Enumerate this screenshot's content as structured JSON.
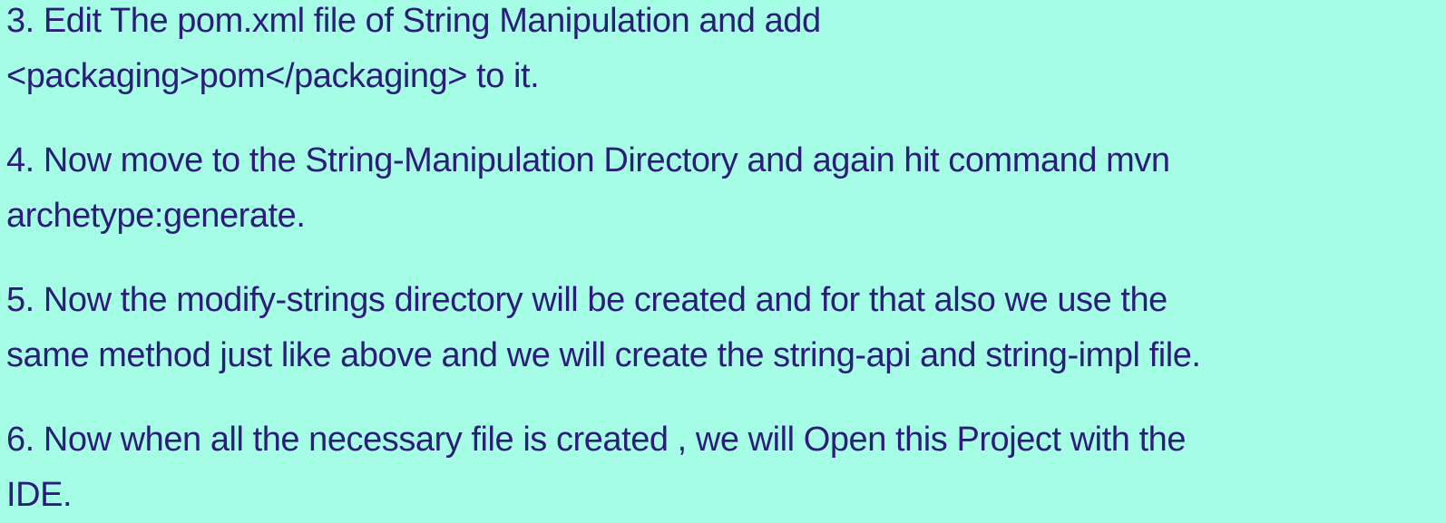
{
  "steps": [
    {
      "lines": [
        "3. Edit The pom.xml file of String Manipulation and add",
        "<packaging>pom</packaging> to it."
      ]
    },
    {
      "lines": [
        "4. Now move to the String-Manipulation Directory and again hit command mvn",
        "archetype:generate."
      ]
    },
    {
      "lines": [
        "5. Now the modify-strings directory will be created and for that also we use the",
        "same method just like above and we will create the string-api and string-impl file."
      ]
    },
    {
      "lines": [
        "6. Now when all the necessary file is created , we will Open this Project with the",
        "IDE."
      ]
    }
  ]
}
